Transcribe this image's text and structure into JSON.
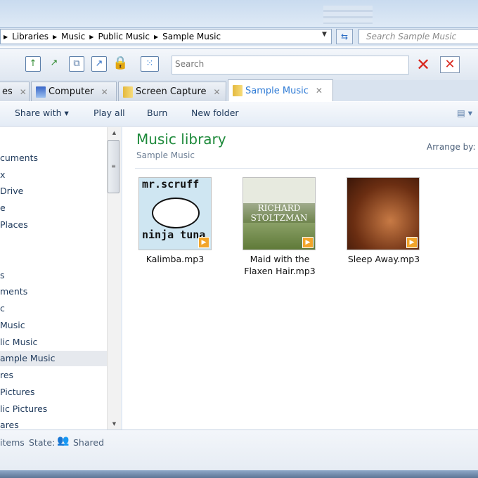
{
  "address": {
    "crumbs": [
      "Libraries",
      "Music",
      "Public Music",
      "Sample Music"
    ],
    "search_placeholder": "Search Sample Music"
  },
  "toolbar": {
    "search_placeholder": "Search"
  },
  "tabs": [
    {
      "label": "es"
    },
    {
      "label": "Computer"
    },
    {
      "label": "Screen Capture"
    },
    {
      "label": "Sample Music",
      "active": true
    }
  ],
  "commands": {
    "share_with": "Share with ▾",
    "play_all": "Play all",
    "burn": "Burn",
    "new_folder": "New folder"
  },
  "nav": {
    "items": [
      "cuments",
      "x",
      "Drive",
      "e",
      "Places",
      "s",
      "ments",
      "c",
      "Music",
      "lic Music",
      "ample Music",
      "res",
      "Pictures",
      "lic Pictures",
      "ares"
    ],
    "selected": "ample Music"
  },
  "library": {
    "title": "Music library",
    "subtitle": "Sample Music",
    "arrange_by": "Arrange by:"
  },
  "files": [
    {
      "name": "Kalimba.mp3",
      "art_text": "mr.scruff ninja tuna"
    },
    {
      "name": "Maid with the Flaxen Hair.mp3",
      "art_text": "RICHARD STOLTZMAN"
    },
    {
      "name": "Sleep Away.mp3",
      "art_text": ""
    }
  ],
  "status": {
    "items": "items",
    "state_label": "State:",
    "state_value": "Shared"
  }
}
